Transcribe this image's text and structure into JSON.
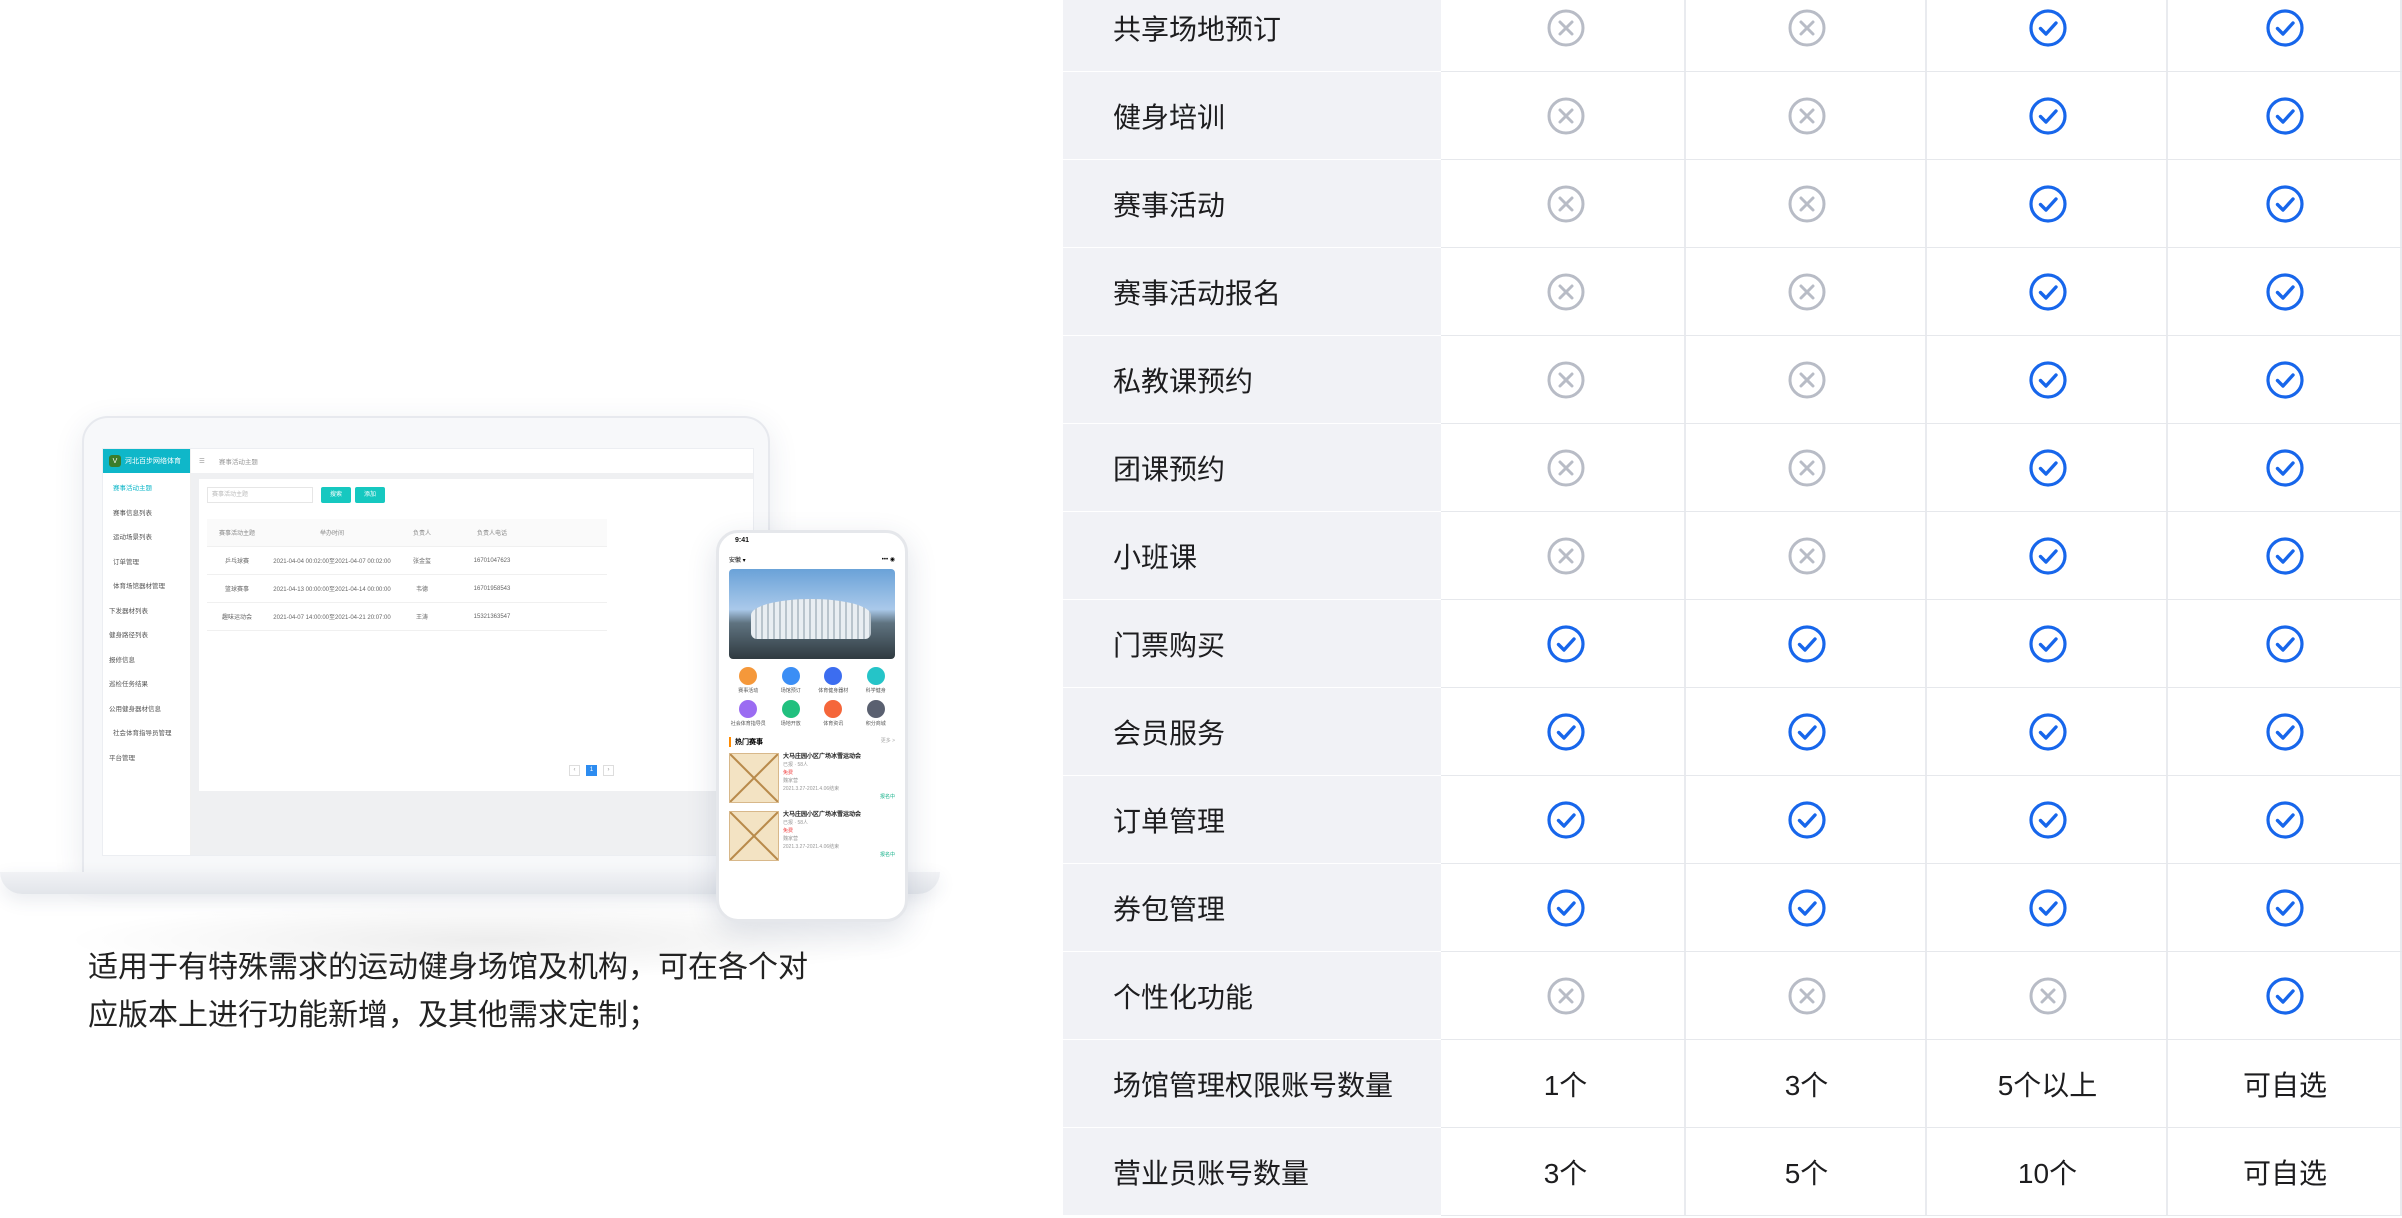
{
  "description": "适用于有特殊需求的运动健身场馆及机构，可在各个对应版本上进行功能新增，及其他需求定制；",
  "admin": {
    "logo_text": "河北百步网络体育",
    "breadcrumb": "赛事活动主题",
    "menu": [
      "赛事活动主题",
      "赛事信息列表",
      "运动场景列表",
      "订单管理",
      "体育场馆器材管理",
      "下发器材列表",
      "健身路径列表",
      "报修信息",
      "巡检任务结果",
      "公用健身器材信息",
      "社会体育指导员管理",
      "平台管理"
    ],
    "search_placeholder": "赛事活动主题",
    "search_btn": "搜索",
    "add_btn": "添加",
    "table_headers": [
      "赛事活动主题",
      "举办时间",
      "负责人",
      "负责人电话"
    ],
    "table_rows": [
      [
        "乒乓球赛",
        "2021-04-04 00:02:00至2021-04-07 00:02:00",
        "张金玺",
        "16701047623"
      ],
      [
        "篮球赛事",
        "2021-04-13 00:00:00至2021-04-14 00:00:00",
        "韦德",
        "16701958543"
      ],
      [
        "趣味运动会",
        "2021-04-07 14:00:00至2021-04-21 20:07:00",
        "王涛",
        "15321363547"
      ]
    ],
    "page": "1"
  },
  "phone": {
    "time": "9:41",
    "location": "安徽 ▾",
    "grid": [
      {
        "label": "赛事活动",
        "color": "#f5983a"
      },
      {
        "label": "场馆预订",
        "color": "#3b8ef5"
      },
      {
        "label": "体育健身器材",
        "color": "#3c6df0"
      },
      {
        "label": "科学健身",
        "color": "#25c4c8"
      },
      {
        "label": "社会体育指导员",
        "color": "#9b6cf2"
      },
      {
        "label": "场地开放",
        "color": "#21c07e"
      },
      {
        "label": "体育资讯",
        "color": "#f5663a"
      },
      {
        "label": "积分商城",
        "color": "#5a6070"
      }
    ],
    "section_title": "热门赛事",
    "section_more": "更多 >",
    "cards": [
      {
        "title": "大马庄园小区广场冰雪运动会",
        "sub": "已报 · 58人",
        "tag": "免费",
        "org": "魏家营",
        "date": "2021.3.27-2021.4.06结束",
        "action": "报名中"
      },
      {
        "title": "大马庄园小区广场冰雪运动会",
        "sub": "已报 · 58人",
        "tag": "免费",
        "org": "魏家营",
        "date": "2021.3.27-2021.4.06结束",
        "action": "报名中"
      }
    ]
  },
  "features": {
    "colors": {
      "check": "#1766eb",
      "cross": "#b8bcc6"
    },
    "rows": [
      {
        "name": "共享场地预订",
        "cells": [
          "cross",
          "cross",
          "check",
          "check"
        ]
      },
      {
        "name": "健身培训",
        "cells": [
          "cross",
          "cross",
          "check",
          "check"
        ]
      },
      {
        "name": "赛事活动",
        "cells": [
          "cross",
          "cross",
          "check",
          "check"
        ]
      },
      {
        "name": "赛事活动报名",
        "cells": [
          "cross",
          "cross",
          "check",
          "check"
        ]
      },
      {
        "name": "私教课预约",
        "cells": [
          "cross",
          "cross",
          "check",
          "check"
        ]
      },
      {
        "name": "团课预约",
        "cells": [
          "cross",
          "cross",
          "check",
          "check"
        ]
      },
      {
        "name": "小班课",
        "cells": [
          "cross",
          "cross",
          "check",
          "check"
        ]
      },
      {
        "name": "门票购买",
        "cells": [
          "check",
          "check",
          "check",
          "check"
        ]
      },
      {
        "name": "会员服务",
        "cells": [
          "check",
          "check",
          "check",
          "check"
        ]
      },
      {
        "name": "订单管理",
        "cells": [
          "check",
          "check",
          "check",
          "check"
        ]
      },
      {
        "name": "券包管理",
        "cells": [
          "check",
          "check",
          "check",
          "check"
        ]
      },
      {
        "name": "个性化功能",
        "cells": [
          "cross",
          "cross",
          "cross",
          "check"
        ]
      },
      {
        "name": "场馆管理权限账号数量",
        "cells": [
          "1个",
          "3个",
          "5个以上",
          "可自选"
        ]
      },
      {
        "name": "营业员账号数量",
        "cells": [
          "3个",
          "5个",
          "10个",
          "可自选"
        ]
      }
    ]
  }
}
